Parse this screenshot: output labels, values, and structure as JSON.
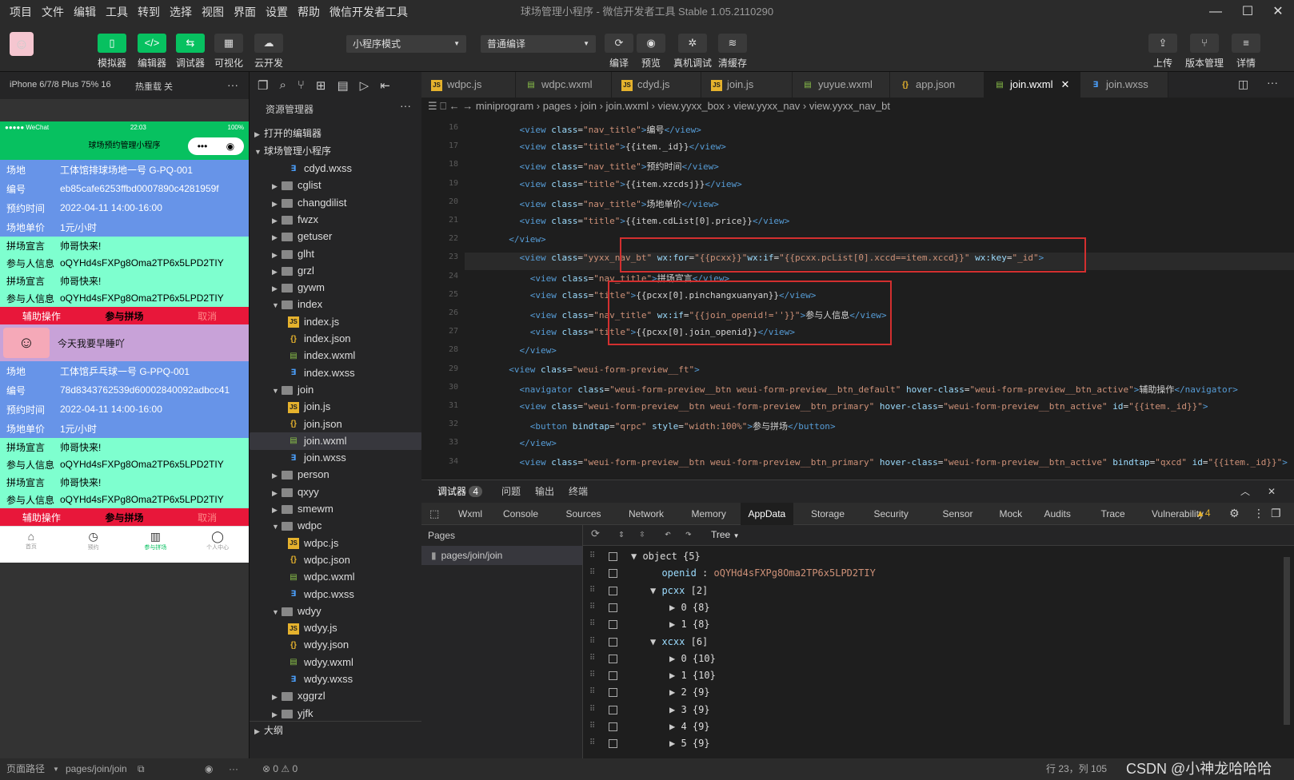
{
  "menu": [
    "项目",
    "文件",
    "编辑",
    "工具",
    "转到",
    "选择",
    "视图",
    "界面",
    "设置",
    "帮助",
    "微信开发者工具"
  ],
  "window_title": "球场管理小程序 - 微信开发者工具 Stable 1.05.2110290",
  "toolbar": {
    "simulator": "模拟器",
    "editor": "编辑器",
    "debugger": "调试器",
    "visual": "可视化",
    "cloud": "云开发",
    "mode": "小程序模式",
    "compile_mode": "普通编译",
    "compile": "编译",
    "preview": "预览",
    "real_debug": "真机调试",
    "clear_cache": "清缓存",
    "upload": "上传",
    "version": "版本管理",
    "detail": "详情"
  },
  "simbar": {
    "device": "iPhone 6/7/8 Plus 75% 16",
    "hotreload": "热重载 关"
  },
  "phone": {
    "carrier": "●●●●● WeChat",
    "time": "22:03",
    "battery": "100%",
    "title": "球场预约管理小程序",
    "card1": [
      {
        "k": "场地",
        "v": "工体馆排球场地一号 G-PQ-001"
      },
      {
        "k": "编号",
        "v": "eb85cafe6253ffbd0007890c4281959f"
      },
      {
        "k": "预约时间",
        "v": "2022-04-11 14:00-16:00"
      },
      {
        "k": "场地单价",
        "v": "1元/小时"
      }
    ],
    "sec_a": [
      {
        "k": "拼场宣言",
        "v": "帅哥快来!"
      },
      {
        "k": "参与人信息",
        "v": "oQYHd4sFXPg8Oma2TP6x5LPD2TIY"
      }
    ],
    "actions": {
      "assist": "辅助操作",
      "join": "参与拼场",
      "cancel": "取消"
    },
    "user_text": "今天我要早睡吖",
    "card2": [
      {
        "k": "场地",
        "v": "工体馆乒乓球一号 G-PPQ-001"
      },
      {
        "k": "编号",
        "v": "78d8343762539d60002840092adbcc41"
      },
      {
        "k": "预约时间",
        "v": "2022-04-11 14:00-16:00"
      },
      {
        "k": "场地单价",
        "v": "1元/小时"
      }
    ],
    "tabs": [
      "首页",
      "预约",
      "参与拼场",
      "个人中心"
    ]
  },
  "explorer": {
    "title": "资源管理器",
    "open_editors": "打开的编辑器",
    "project": "球场管理小程序",
    "outline": "大纲",
    "items": [
      {
        "label": "cdyd.wxss",
        "type": "wxss",
        "depth": 2
      },
      {
        "label": "cglist",
        "type": "folder",
        "depth": 1
      },
      {
        "label": "changdilist",
        "type": "folder",
        "depth": 1
      },
      {
        "label": "fwzx",
        "type": "folder",
        "depth": 1
      },
      {
        "label": "getuser",
        "type": "folder",
        "depth": 1
      },
      {
        "label": "glht",
        "type": "folder",
        "depth": 1
      },
      {
        "label": "grzl",
        "type": "folder",
        "depth": 1
      },
      {
        "label": "gywm",
        "type": "folder",
        "depth": 1
      },
      {
        "label": "index",
        "type": "folder-open",
        "depth": 1
      },
      {
        "label": "index.js",
        "type": "js",
        "depth": 2
      },
      {
        "label": "index.json",
        "type": "json",
        "depth": 2
      },
      {
        "label": "index.wxml",
        "type": "wxml",
        "depth": 2
      },
      {
        "label": "index.wxss",
        "type": "wxss",
        "depth": 2
      },
      {
        "label": "join",
        "type": "folder-open",
        "depth": 1
      },
      {
        "label": "join.js",
        "type": "js",
        "depth": 2
      },
      {
        "label": "join.json",
        "type": "json",
        "depth": 2
      },
      {
        "label": "join.wxml",
        "type": "wxml",
        "depth": 2,
        "selected": true
      },
      {
        "label": "join.wxss",
        "type": "wxss",
        "depth": 2
      },
      {
        "label": "person",
        "type": "folder",
        "depth": 1
      },
      {
        "label": "qxyy",
        "type": "folder",
        "depth": 1
      },
      {
        "label": "smewm",
        "type": "folder",
        "depth": 1
      },
      {
        "label": "wdpc",
        "type": "folder-open",
        "depth": 1
      },
      {
        "label": "wdpc.js",
        "type": "js",
        "depth": 2
      },
      {
        "label": "wdpc.json",
        "type": "json",
        "depth": 2
      },
      {
        "label": "wdpc.wxml",
        "type": "wxml",
        "depth": 2
      },
      {
        "label": "wdpc.wxss",
        "type": "wxss",
        "depth": 2
      },
      {
        "label": "wdyy",
        "type": "folder-open",
        "depth": 1
      },
      {
        "label": "wdyy.js",
        "type": "js",
        "depth": 2
      },
      {
        "label": "wdyy.json",
        "type": "json",
        "depth": 2
      },
      {
        "label": "wdyy.wxml",
        "type": "wxml",
        "depth": 2
      },
      {
        "label": "wdyy.wxss",
        "type": "wxss",
        "depth": 2
      },
      {
        "label": "xggrzl",
        "type": "folder",
        "depth": 1
      },
      {
        "label": "yjfk",
        "type": "folder",
        "depth": 1
      }
    ]
  },
  "tabs": [
    {
      "label": "wdpc.js",
      "type": "js"
    },
    {
      "label": "wdpc.wxml",
      "type": "wxml"
    },
    {
      "label": "cdyd.js",
      "type": "js"
    },
    {
      "label": "join.js",
      "type": "js"
    },
    {
      "label": "yuyue.wxml",
      "type": "wxml"
    },
    {
      "label": "app.json",
      "type": "json"
    },
    {
      "label": "join.wxml",
      "type": "wxml",
      "active": true
    },
    {
      "label": "join.wxss",
      "type": "wxss"
    }
  ],
  "breadcrumb": [
    "miniprogram",
    "pages",
    "join",
    "join.wxml",
    "view.yyxx_box",
    "view.yyxx_nav",
    "view.yyxx_nav_bt"
  ],
  "code": [
    {
      "n": "16",
      "t": "    <view class=\"nav_title\">编号</view>"
    },
    {
      "n": "17",
      "t": "    <view class=\"title\">{{item._id}}</view>"
    },
    {
      "n": "18",
      "t": "    <view class=\"nav_title\">预约时间</view>"
    },
    {
      "n": "19",
      "t": "    <view class=\"title\">{{item.xzcdsj}}</view>"
    },
    {
      "n": "20",
      "t": "    <view class=\"nav_title\">场地单价</view>"
    },
    {
      "n": "21",
      "t": "    <view class=\"title\">{{item.cdList[0].price}}</view>"
    },
    {
      "n": "22",
      "t": "  </view>"
    },
    {
      "n": "23",
      "t": "    <view class=\"yyxx_nav_bt\" wx:for=\"{{pcxx}}\"wx:if=\"{{pcxx.pcList[0].xccd==item.xccd}}\" wx:key=\"_id\">"
    },
    {
      "n": "24",
      "t": "      <view class=\"nav_title\">拼场宣言</view>"
    },
    {
      "n": "25",
      "t": "      <view class=\"title\">{{pcxx[0].pinchangxuanyan}}</view>"
    },
    {
      "n": "26",
      "t": "      <view class=\"nav_title\" wx:if=\"{{join_openid!=''}}\">参与人信息</view>"
    },
    {
      "n": "27",
      "t": "      <view class=\"title\">{{pcxx[0].join_openid}}</view>"
    },
    {
      "n": "28",
      "t": "    </view>"
    },
    {
      "n": "29",
      "t": "  <view class=\"weui-form-preview__ft\">"
    },
    {
      "n": "30",
      "t": "    <navigator class=\"weui-form-preview__btn weui-form-preview__btn_default\" hover-class=\"weui-form-preview__btn_active\">辅助操作</navigator>"
    },
    {
      "n": "31",
      "t": "    <view class=\"weui-form-preview__btn weui-form-preview__btn_primary\" hover-class=\"weui-form-preview__btn_active\" id=\"{{item._id}}\">"
    },
    {
      "n": "32",
      "t": "      <button bindtap=\"qrpc\" style=\"width:100%\">参与拼场</button>"
    },
    {
      "n": "33",
      "t": "    </view>"
    },
    {
      "n": "34",
      "t": "    <view class=\"weui-form-preview__btn weui-form-preview__btn_primary\" hover-class=\"weui-form-preview__btn_active\" bindtap=\"qxcd\" id=\"{{item._id}}\">"
    }
  ],
  "devtools": {
    "debugger": "调试器",
    "count": "4",
    "issues": "问题",
    "output": "输出",
    "terminal": "终端",
    "panels": [
      "Wxml",
      "Console",
      "Sources",
      "Network",
      "Memory",
      "AppData",
      "Storage",
      "Security",
      "Sensor",
      "Mock",
      "Audits",
      "Trace",
      "Vulnerability"
    ],
    "active_panel": "AppData",
    "warnings": "▲4",
    "pages_label": "Pages",
    "page_path": "pages/join/join",
    "tree_mode": "Tree",
    "tree": [
      {
        "indent": 0,
        "arrow": "▼",
        "key": "object",
        "val": "{5}",
        "kc": "tw"
      },
      {
        "indent": 1,
        "arrow": "",
        "key": "openid",
        "val": "oQYHd4sFXPg8Oma2TP6x5LPD2TIY",
        "colon": true
      },
      {
        "indent": 1,
        "arrow": "▼",
        "key": "pcxx",
        "val": "[2]"
      },
      {
        "indent": 2,
        "arrow": "▶",
        "key": "0",
        "val": "{8}",
        "kc": "tw"
      },
      {
        "indent": 2,
        "arrow": "▶",
        "key": "1",
        "val": "{8}",
        "kc": "tw"
      },
      {
        "indent": 1,
        "arrow": "▼",
        "key": "xcxx",
        "val": "[6]"
      },
      {
        "indent": 2,
        "arrow": "▶",
        "key": "0",
        "val": "{10}",
        "kc": "tw"
      },
      {
        "indent": 2,
        "arrow": "▶",
        "key": "1",
        "val": "{10}",
        "kc": "tw"
      },
      {
        "indent": 2,
        "arrow": "▶",
        "key": "2",
        "val": "{9}",
        "kc": "tw"
      },
      {
        "indent": 2,
        "arrow": "▶",
        "key": "3",
        "val": "{9}",
        "kc": "tw"
      },
      {
        "indent": 2,
        "arrow": "▶",
        "key": "4",
        "val": "{9}",
        "kc": "tw"
      },
      {
        "indent": 2,
        "arrow": "▶",
        "key": "5",
        "val": "{9}",
        "kc": "tw"
      }
    ]
  },
  "status": {
    "page_path_label": "页面路径",
    "page_path": "pages/join/join",
    "errors": "⊗ 0 ⚠ 0",
    "position": "行 23，列 105",
    "watermark": "CSDN @小神龙哈哈哈"
  }
}
